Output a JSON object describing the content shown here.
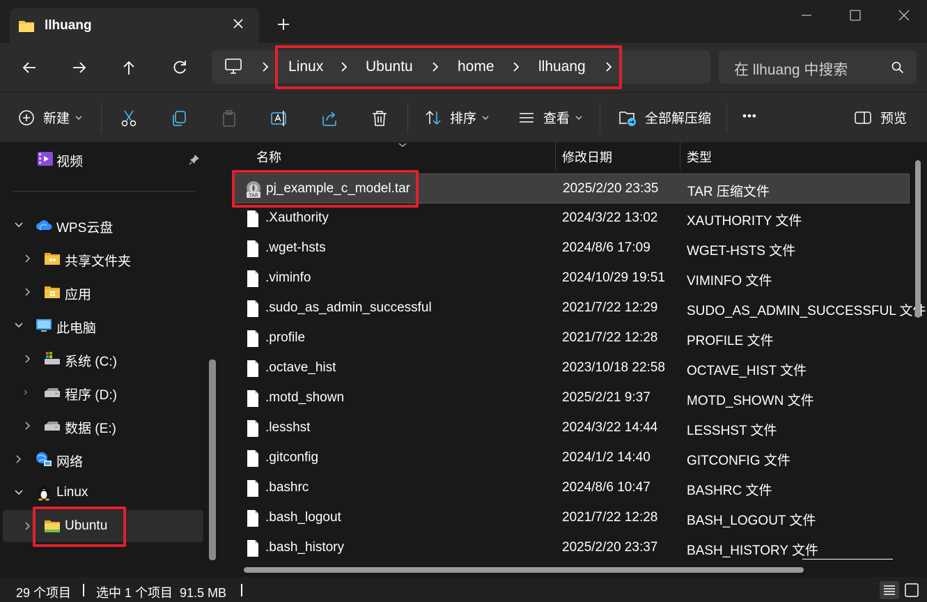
{
  "window": {
    "tab_title": "llhuang"
  },
  "breadcrumb": [
    "Linux",
    "Ubuntu",
    "home",
    "llhuang"
  ],
  "search": {
    "placeholder": "在 llhuang 中搜索"
  },
  "toolbar": {
    "new_label": "新建",
    "sort_label": "排序",
    "view_label": "查看",
    "extract_label": "全部解压缩",
    "more_label": "•••",
    "preview_label": "预览"
  },
  "sidebar": {
    "pinned": [
      {
        "label": "视频",
        "icon": "video-icon"
      }
    ],
    "items": [
      {
        "label": "WPS云盘",
        "icon": "cloud-icon"
      },
      {
        "label": "共享文件夹",
        "icon": "folder-icon"
      },
      {
        "label": "应用",
        "icon": "folder-icon"
      },
      {
        "label": "此电脑",
        "icon": "computer-icon"
      },
      {
        "label": "系统 (C:)",
        "icon": "drive-icon"
      },
      {
        "label": "程序 (D:)",
        "icon": "drive-icon"
      },
      {
        "label": "数据 (E:)",
        "icon": "drive-icon"
      },
      {
        "label": "网络",
        "icon": "network-icon"
      },
      {
        "label": "Linux",
        "icon": "penguin-icon"
      },
      {
        "label": "Ubuntu",
        "icon": "folder-icon"
      }
    ]
  },
  "columns": {
    "name": "名称",
    "date": "修改日期",
    "type": "类型"
  },
  "files": [
    {
      "name": "pj_example_c_model.tar",
      "date": "2025/2/20 23:35",
      "type": "TAR 压缩文件"
    },
    {
      "name": ".Xauthority",
      "date": "2024/3/22 13:02",
      "type": "XAUTHORITY 文件"
    },
    {
      "name": ".wget-hsts",
      "date": "2024/8/6 17:09",
      "type": "WGET-HSTS 文件"
    },
    {
      "name": ".viminfo",
      "date": "2024/10/29 19:51",
      "type": "VIMINFO 文件"
    },
    {
      "name": ".sudo_as_admin_successful",
      "date": "2021/7/22 12:29",
      "type": "SUDO_AS_ADMIN_SUCCESSFUL 文件"
    },
    {
      "name": ".profile",
      "date": "2021/7/22 12:28",
      "type": "PROFILE 文件"
    },
    {
      "name": ".octave_hist",
      "date": "2023/10/18 22:58",
      "type": "OCTAVE_HIST 文件"
    },
    {
      "name": ".motd_shown",
      "date": "2025/2/21 9:37",
      "type": "MOTD_SHOWN 文件"
    },
    {
      "name": ".lesshst",
      "date": "2024/3/22 14:44",
      "type": "LESSHST 文件"
    },
    {
      "name": ".gitconfig",
      "date": "2024/1/2 14:40",
      "type": "GITCONFIG 文件"
    },
    {
      "name": ".bashrc",
      "date": "2024/8/6 10:47",
      "type": "BASHRC 文件"
    },
    {
      "name": ".bash_logout",
      "date": "2021/7/22 12:28",
      "type": "BASH_LOGOUT 文件"
    },
    {
      "name": ".bash_history",
      "date": "2025/2/20 23:37",
      "type": "BASH_HISTORY 文件"
    }
  ],
  "status": {
    "count": "29 个项目",
    "selection": "选中 1 个项目  91.5 MB"
  },
  "colors": {
    "highlight": "#e0202c",
    "folder": "#f5c542",
    "accent": "#4cc2ff"
  }
}
